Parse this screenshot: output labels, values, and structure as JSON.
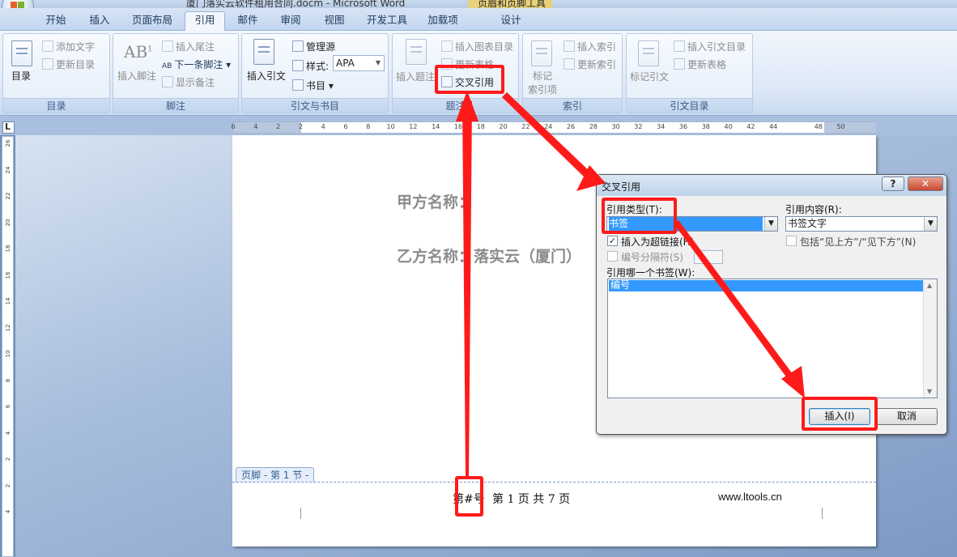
{
  "window": {
    "title": "厦门落实云软件租用合同.docm - Microsoft Word",
    "context_tab_group": "页眉和页脚工具"
  },
  "tabs": [
    "开始",
    "插入",
    "页面布局",
    "引用",
    "邮件",
    "审阅",
    "视图",
    "开发工具",
    "加载项",
    "设计"
  ],
  "active_tab": "引用",
  "ribbon": {
    "toc": {
      "label": "目录",
      "big_button": "目录",
      "add_text": "添加文字",
      "update_toc": "更新目录"
    },
    "footnotes": {
      "label": "脚注",
      "insert_footnote": "插入脚注",
      "insert_endnote": "插入尾注",
      "next_footnote": "下一条脚注",
      "show_notes": "显示备注",
      "ab_glyph": "AB",
      "sup_glyph": "1",
      "small_ab": "AB"
    },
    "citations": {
      "label": "引文与书目",
      "insert_citation": "插入引文",
      "manage_sources": "管理源",
      "style_label": "样式:",
      "style_value": "APA",
      "bibliography": "书目"
    },
    "captions": {
      "label": "题注",
      "insert_caption": "插入题注",
      "insert_table_of_figures": "插入图表目录",
      "update_table": "更新表格",
      "cross_reference": "交叉引用"
    },
    "index": {
      "label": "索引",
      "mark_entry_line1": "标记",
      "mark_entry_line2": "索引项",
      "insert_index": "插入索引",
      "update_index": "更新索引"
    },
    "toa": {
      "label": "引文目录",
      "mark_citation": "标记引文",
      "insert_toa": "插入引文目录",
      "update_table": "更新表格"
    }
  },
  "ruler": {
    "ticks": [
      "6",
      "4",
      "2",
      "2",
      "4",
      "6",
      "8",
      "10",
      "12",
      "14",
      "16",
      "18",
      "20",
      "22",
      "24",
      "26",
      "28",
      "30",
      "32",
      "34",
      "36",
      "38",
      "40",
      "42",
      "44",
      "48",
      "50"
    ],
    "vertical_ticks": [
      "26",
      "24",
      "22",
      "20",
      "18",
      "16",
      "14",
      "12",
      "10",
      "8",
      "6",
      "4",
      "2",
      "2",
      "4"
    ],
    "corner_glyph": "L"
  },
  "document": {
    "party_a": "甲方名称：",
    "party_b": "乙方名称：落实云（厦门）",
    "footer_tag": "页脚 - 第 1 节 -",
    "footer_prefix": "第",
    "footer_field": "#号",
    "footer_page_text": "第 1 页 共 7 页",
    "footer_site": "www.ltools.cn"
  },
  "dialog": {
    "title": "交叉引用",
    "help_glyph": "?",
    "close_glyph": "✕",
    "ref_type_label": "引用类型(T):",
    "ref_type_value": "书签",
    "ref_content_label": "引用内容(R):",
    "ref_content_value": "书签文字",
    "insert_hyperlink_label": "插入为超链接(H)",
    "insert_hyperlink_checked": true,
    "check_glyph": "✓",
    "above_below_label": "包括“见上方”/“见下方”(N)",
    "separator_label": "编号分隔符(S)",
    "which_bookmark_label": "引用哪一个书签(W):",
    "bookmarks": [
      "编号"
    ],
    "insert_button": "插入(I)",
    "cancel_button": "取消"
  },
  "annotation_color": "#ff1a1a"
}
